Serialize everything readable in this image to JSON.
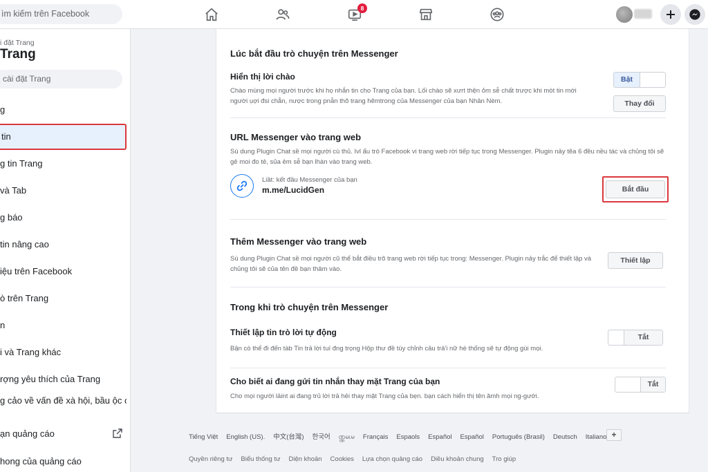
{
  "topbar": {
    "search_placeholder": "ìm kiếm trên Facebook",
    "notification_count": "8"
  },
  "sidebar": {
    "breadcrumb": "i đặt Trang",
    "title": "Trang",
    "search_placeholder": "i cài đặt Trang",
    "items": [
      {
        "label": "g"
      },
      {
        "label": "tin"
      },
      {
        "label": "g tin Trang"
      },
      {
        "label": "và Tab"
      },
      {
        "label": "g báo"
      },
      {
        "label": "tin nâng cao"
      },
      {
        "label": "iệu trên Facebook"
      },
      {
        "label": "ò trên Trang"
      },
      {
        "label": "n"
      },
      {
        "label": "i và Trang khác"
      },
      {
        "label": "rợng yêu thích của Trang"
      },
      {
        "label": "g cảo về vấn đề xà hội, bầu ộc chính trị"
      },
      {
        "label": "ạn quảng cáo"
      },
      {
        "label": "hong của quảng cáo"
      }
    ]
  },
  "main": {
    "section1": {
      "title": "Lúc bắt đầu trò chuyện trên Messenger",
      "greeting": {
        "title": "Hiển thị lời chào",
        "desc": "Chào mùng mọi người trước khi họ nhắn tin cho Trang của bạn. Lối chào sẽ xưrt thện ỏm sễ chất trược khi mòt tin mới người ụợi đsi chẵn, nược trong pnẫn thõ trang hẽmtrong của Messenger của bạn Nhân Nèm.",
        "toggle_on": "Bật",
        "change_button": "Thay đổi"
      }
    },
    "section2": {
      "title": "URL Messenger vào trang web",
      "desc": "Sù dung Plugin Chat sề mọi người cù thủ. Ivl ẩu trò Facebook vi trang web rời tiếp tục trong Messenger. Plugin nảy tẽa 6 đều nều tác và chủng tôi sẽ gẻ moi đo tẻ, sủa ẻm sễ bạn lhàn vào trang web.",
      "url_caption": "Liầt: kết đầu Messenger của bạn",
      "url_value": "m.me/LucidGen",
      "start_button": "Bắt đầu"
    },
    "section3": {
      "title": "Thêm Messenger vào trang web",
      "desc": "Sù dung Plugin Chat sề mọi người cũ thể bắt điều trõ trang web rời tiếp tục trong: Messenger. Plugin nảy trắc để thiết lập và chủng tôi sẽ của tên đề bạn thâm vào.",
      "setup_button": "Thiết lập"
    },
    "section4": {
      "title": "Trong khi trò chuyện trên Messenger",
      "autoreply": {
        "title": "Thiết lập tin trò lời tự động",
        "desc": "Bận cò thể đi đến tàb Tin trả lời tuí đng trọng Hộp thư đề tùy chỉnh câu trả'i nữ hè thống sẽ tự động gùi mọi.",
        "toggle_label": "Tắt"
      },
      "identity": {
        "title": "Cho biết ai đang gửi tin nhắn thay mặt Trang của bạn",
        "desc": "Cho mọi người lảint ai đang trủ lời trả hẻi thay mặt Trang của bẹn. bạn cách hiển thị tên ămh mọi ng-gưới.",
        "toggle_label": "Tắt"
      }
    }
  },
  "footer": {
    "languages": [
      "Tiếng Việt",
      "English (US).",
      "中文(台灣)",
      "한국어",
      "ဏ္ဏမၬမ",
      "Français",
      "Espaols",
      "Español",
      "Español",
      "Português (Brasil)",
      "Deutsch",
      "Italiano"
    ],
    "more_languages": "+",
    "links": [
      "Quyền riêng tư",
      "Biểu thống tư",
      "Diện khoản",
      "Cookies",
      "Lựa chọn quảng cáo",
      "Diều khoản chung",
      "Tro giúp"
    ]
  },
  "colors": {
    "accent": "#1877f2",
    "highlight_border": "#d9383c",
    "badge": "#e41e3f"
  },
  "icons": [
    "home-icon",
    "friends-icon",
    "watch-icon",
    "marketplace-icon",
    "groups-icon",
    "plus-icon",
    "messenger-icon",
    "link-icon",
    "external-link-icon"
  ]
}
